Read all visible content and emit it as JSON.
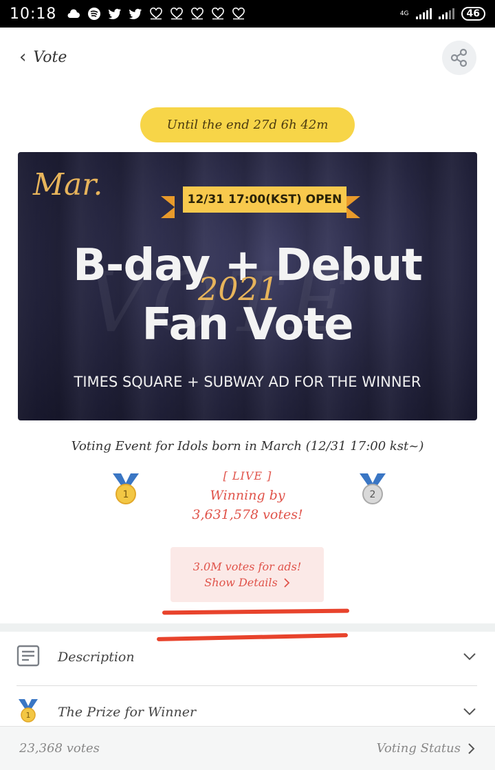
{
  "status_bar": {
    "time": "10:18",
    "network": "4G",
    "battery": "46",
    "notification_icons": [
      "cloud-icon",
      "spotify-icon",
      "twitter-icon",
      "twitter-icon",
      "heart-icon",
      "heart-icon",
      "heart-icon",
      "heart-icon",
      "heart-icon"
    ]
  },
  "header": {
    "back_label": "Vote",
    "share_icon": "share-icon"
  },
  "countdown": "Until the end 27d 6h 42m",
  "banner": {
    "month": "Mar.",
    "ribbon": "12/31 17:00(KST) OPEN",
    "headline_line1": "B-day + Debut",
    "year": "2021",
    "headline_line2": "Fan Vote",
    "watermark": "VOTE",
    "subline": "TIMES SQUARE + SUBWAY AD FOR THE WINNER"
  },
  "event": {
    "title": "Voting Event for Idols born in March (12/31 17:00 kst~)",
    "rank1": "1",
    "rank2": "2",
    "live": "[ LIVE ]",
    "winning_by": "Winning by",
    "margin": "3,631,578 votes!"
  },
  "ads": {
    "line1": "3.0M votes for ads!",
    "details": "Show Details"
  },
  "sections": [
    {
      "label": "Description",
      "icon": "description-icon"
    },
    {
      "label": "The Prize for Winner",
      "icon": "medal-icon"
    }
  ],
  "bottom": {
    "total_votes": "23,368 votes",
    "status_link": "Voting Status"
  },
  "colors": {
    "accent_yellow": "#f7d548",
    "live_red": "#e0534a",
    "gold": "#e7b45b"
  }
}
